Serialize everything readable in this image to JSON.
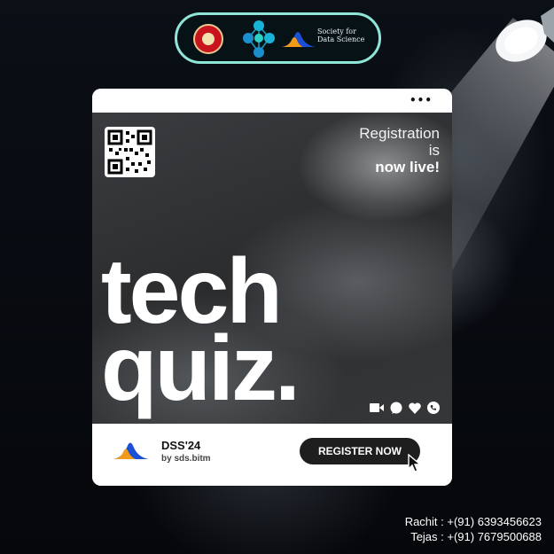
{
  "header": {
    "logos": [
      "college-seal-logo",
      "network-logo",
      "sds-logo"
    ],
    "sds_name_line1": "Society for",
    "sds_name_line2": "Data Science"
  },
  "card": {
    "menu_icon": "more-dots-icon",
    "registration_line1": "Registration",
    "registration_line2": "is",
    "registration_line3": "now live!",
    "title_line1": "tech",
    "title_line2": "quiz.",
    "social_icons": [
      "video-icon",
      "chat-icon",
      "heart-icon",
      "phone-icon"
    ],
    "event_name": "DSS'24",
    "event_by": "by sds.bitm",
    "register_label": "REGISTER NOW"
  },
  "contacts": {
    "line1": "Rachit : +(91) 6393456623",
    "line2": "Tejas : +(91) 7679500688"
  },
  "colors": {
    "background": "#05070b",
    "pill_border": "#8fe6d8",
    "button": "#1e1e1e",
    "logo_blue": "#1a4fd6",
    "logo_orange": "#f29a1a"
  }
}
